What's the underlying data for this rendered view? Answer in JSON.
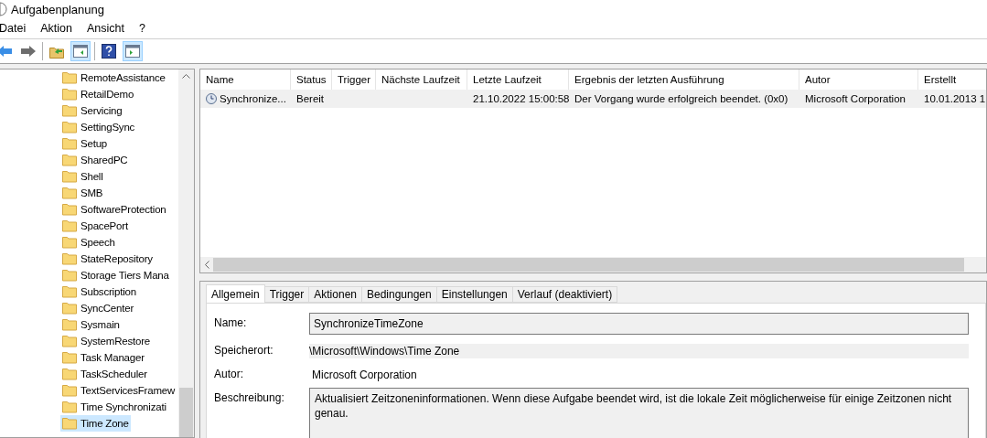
{
  "window": {
    "title": "Aufgabenplanung"
  },
  "menu": [
    "Datei",
    "Aktion",
    "Ansicht",
    "?"
  ],
  "toolbar": [
    {
      "kind": "back",
      "pressed": false
    },
    {
      "kind": "forward",
      "pressed": false
    },
    {
      "kind": "sep"
    },
    {
      "kind": "up",
      "pressed": false
    },
    {
      "kind": "panel-left",
      "pressed": true
    },
    {
      "kind": "sep"
    },
    {
      "kind": "help",
      "pressed": false
    },
    {
      "kind": "panel-right",
      "pressed": true
    }
  ],
  "tree": {
    "items": [
      {
        "label": "RemoteAssistance",
        "selected": false
      },
      {
        "label": "RetailDemo",
        "selected": false
      },
      {
        "label": "Servicing",
        "selected": false
      },
      {
        "label": "SettingSync",
        "selected": false
      },
      {
        "label": "Setup",
        "selected": false
      },
      {
        "label": "SharedPC",
        "selected": false
      },
      {
        "label": "Shell",
        "selected": false
      },
      {
        "label": "SMB",
        "selected": false
      },
      {
        "label": "SoftwareProtection",
        "selected": false
      },
      {
        "label": "SpacePort",
        "selected": false
      },
      {
        "label": "Speech",
        "selected": false
      },
      {
        "label": "StateRepository",
        "selected": false
      },
      {
        "label": "Storage Tiers Mana",
        "selected": false
      },
      {
        "label": "Subscription",
        "selected": false
      },
      {
        "label": "SyncCenter",
        "selected": false
      },
      {
        "label": "Sysmain",
        "selected": false
      },
      {
        "label": "SystemRestore",
        "selected": false
      },
      {
        "label": "Task Manager",
        "selected": false
      },
      {
        "label": "TaskScheduler",
        "selected": false
      },
      {
        "label": "TextServicesFramew",
        "selected": false
      },
      {
        "label": "Time Synchronizati",
        "selected": false
      },
      {
        "label": "Time Zone",
        "selected": true
      }
    ]
  },
  "table": {
    "columns": [
      "Name",
      "Status",
      "Trigger",
      "Nächste Laufzeit",
      "Letzte Laufzeit",
      "Ergebnis der letzten Ausführung",
      "Autor",
      "Erstellt"
    ],
    "rows": [
      {
        "selected": false,
        "cells": [
          "Synchronize...",
          "Bereit",
          "",
          "",
          "21.10.2022 15:00:58",
          "Der Vorgang wurde erfolgreich beendet. (0x0)",
          "Microsoft Corporation",
          "10.01.2013 1"
        ]
      }
    ]
  },
  "details": {
    "tabs": [
      {
        "label": "Allgemein",
        "selected": true
      },
      {
        "label": "Trigger",
        "selected": false
      },
      {
        "label": "Aktionen",
        "selected": false
      },
      {
        "label": "Bedingungen",
        "selected": false
      },
      {
        "label": "Einstellungen",
        "selected": false
      },
      {
        "label": "Verlauf (deaktiviert)",
        "selected": false
      }
    ],
    "fields": [
      {
        "kind": "input",
        "label": "Name:",
        "value": "SynchronizeTimeZone"
      },
      {
        "kind": "readonly",
        "label": "Speicherort:",
        "value": "\\Microsoft\\Windows\\Time Zone"
      },
      {
        "kind": "plain",
        "label": "Autor:",
        "value": "Microsoft Corporation"
      },
      {
        "kind": "textarea",
        "label": "Beschreibung:",
        "value": "Aktualisiert Zeitzoneninformationen. Wenn diese Aufgabe beendet wird, ist die lokale Zeit möglicherweise für einige Zeitzonen nicht genau."
      }
    ]
  }
}
